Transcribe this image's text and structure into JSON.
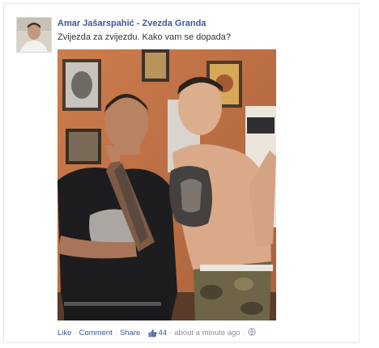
{
  "post": {
    "author": "Amar Jašarspahić - Zvezda Granda",
    "message": "Zvijezda za zvijezdu. Kako vam se dopada?"
  },
  "actions": {
    "like_label": "Like",
    "comment_label": "Comment",
    "share_label": "Share",
    "like_count": "44",
    "timestamp": "about a minute ago"
  },
  "icons": {
    "like_count": "thumbs-up-icon",
    "privacy": "globe-icon"
  },
  "colors": {
    "link": "#3b5998",
    "meta": "#8b8f99"
  }
}
